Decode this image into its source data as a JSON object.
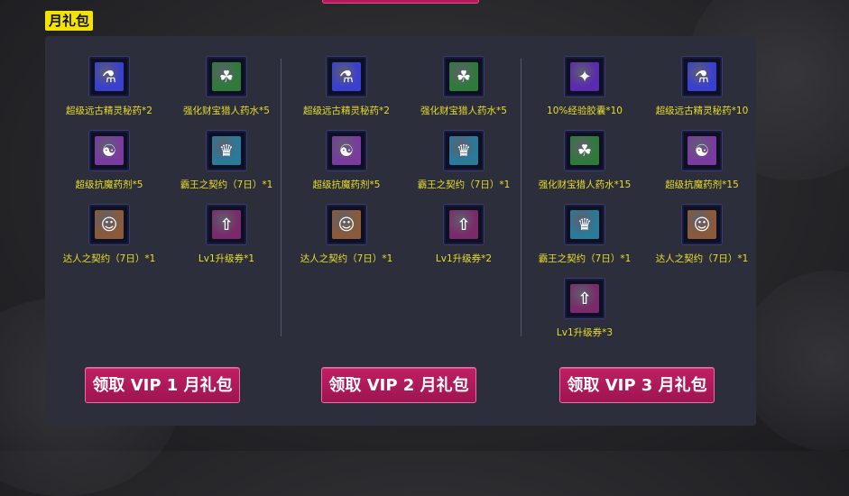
{
  "section_tag": "月礼包",
  "columns": [
    {
      "items": [
        {
          "label": "超级远古精灵秘药*2",
          "icon": "potion-blue-icon",
          "color": "#3a3fd0",
          "glyph": "⚗"
        },
        {
          "label": "强化财宝猎人药水*5",
          "icon": "treasure-potion-icon",
          "color": "#2f7a3a",
          "glyph": "☘"
        },
        {
          "label": "超级抗魔药剂*5",
          "icon": "anti-magic-potion-icon",
          "color": "#7a3aa0",
          "glyph": "☯"
        },
        {
          "label": "霸王之契约（7日）*1",
          "icon": "overlord-contract-icon",
          "color": "#2a7a9a",
          "glyph": "♛"
        },
        {
          "label": "达人之契约（7日）*1",
          "icon": "expert-contract-icon",
          "color": "#8a5a3a",
          "glyph": "☺"
        },
        {
          "label": "Lv1升级券*1",
          "icon": "level-ticket-icon",
          "color": "#7a2a6a",
          "glyph": "⇧"
        }
      ],
      "button": "领取 VIP 1 月礼包"
    },
    {
      "items": [
        {
          "label": "超级远古精灵秘药*2",
          "icon": "potion-blue-icon",
          "color": "#3a3fd0",
          "glyph": "⚗"
        },
        {
          "label": "强化财宝猎人药水*5",
          "icon": "treasure-potion-icon",
          "color": "#2f7a3a",
          "glyph": "☘"
        },
        {
          "label": "超级抗魔药剂*5",
          "icon": "anti-magic-potion-icon",
          "color": "#7a3aa0",
          "glyph": "☯"
        },
        {
          "label": "霸王之契约（7日）*1",
          "icon": "overlord-contract-icon",
          "color": "#2a7a9a",
          "glyph": "♛"
        },
        {
          "label": "达人之契约（7日）*1",
          "icon": "expert-contract-icon",
          "color": "#8a5a3a",
          "glyph": "☺"
        },
        {
          "label": "Lv1升级券*2",
          "icon": "level-ticket-icon",
          "color": "#7a2a6a",
          "glyph": "⇧"
        }
      ],
      "button": "领取 VIP 2 月礼包"
    },
    {
      "items": [
        {
          "label": "10%经验胶囊*10",
          "icon": "exp-capsule-icon",
          "color": "#5a2ab0",
          "glyph": "✦"
        },
        {
          "label": "超级远古精灵秘药*10",
          "icon": "potion-blue-icon",
          "color": "#3a3fd0",
          "glyph": "⚗"
        },
        {
          "label": "强化财宝猎人药水*15",
          "icon": "treasure-potion-icon",
          "color": "#2f7a3a",
          "glyph": "☘"
        },
        {
          "label": "超级抗魔药剂*15",
          "icon": "anti-magic-potion-icon",
          "color": "#7a3aa0",
          "glyph": "☯"
        },
        {
          "label": "霸王之契约（7日）*1",
          "icon": "overlord-contract-icon",
          "color": "#2a7a9a",
          "glyph": "♛"
        },
        {
          "label": "达人之契约（7日）*1",
          "icon": "expert-contract-icon",
          "color": "#8a5a3a",
          "glyph": "☺"
        },
        {
          "label": "Lv1升级券*3",
          "icon": "level-ticket-icon",
          "color": "#7a2a6a",
          "glyph": "⇧"
        }
      ],
      "button": "领取 VIP 3 月礼包"
    }
  ],
  "colors": {
    "tag_bg": "#f2e400",
    "label": "#e8de2a",
    "button": "#b01a5a",
    "panel": "#2d2e3b"
  }
}
